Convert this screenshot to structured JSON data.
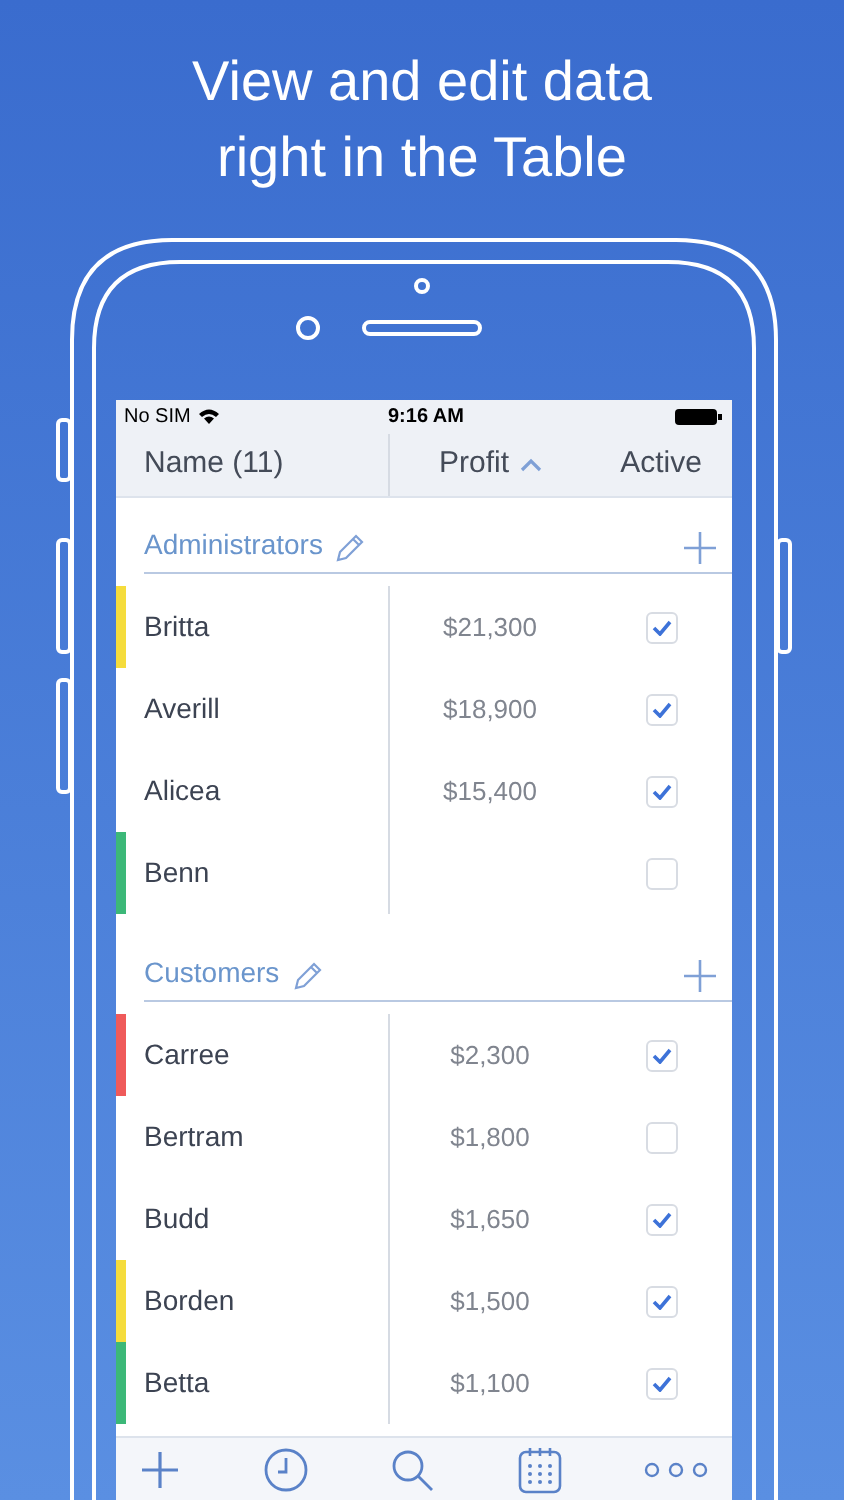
{
  "headline": [
    "View and edit data",
    "right in the Table"
  ],
  "status_bar": {
    "carrier": "No SIM",
    "time": "9:16 AM"
  },
  "columns": [
    {
      "label": "Name (11)",
      "sorted_ascending": false
    },
    {
      "label": "Profit",
      "sorted_ascending": true
    },
    {
      "label": "Active",
      "sorted_ascending": false
    }
  ],
  "groups": [
    {
      "title": "Administrators",
      "rows": [
        {
          "name": "Britta",
          "profit": "$21,300",
          "active": true,
          "color": "#f5dc3c"
        },
        {
          "name": "Averill",
          "profit": "$18,900",
          "active": true
        },
        {
          "name": "Alicea",
          "profit": "$15,400",
          "active": true
        },
        {
          "name": "Benn",
          "active": false,
          "color": "#3cb878"
        }
      ]
    },
    {
      "title": "Customers",
      "rows": [
        {
          "name": "Carree",
          "profit": "$2,300",
          "active": true,
          "color": "#ef5a5a"
        },
        {
          "name": "Bertram",
          "profit": "$1,800",
          "active": false
        },
        {
          "name": "Budd",
          "profit": "$1,650",
          "active": true
        },
        {
          "name": "Borden",
          "profit": "$1,500",
          "active": true,
          "color": "#f5dc3c"
        },
        {
          "name": "Betta",
          "profit": "$1,100",
          "active": true,
          "color": "#3cb878"
        }
      ]
    }
  ]
}
